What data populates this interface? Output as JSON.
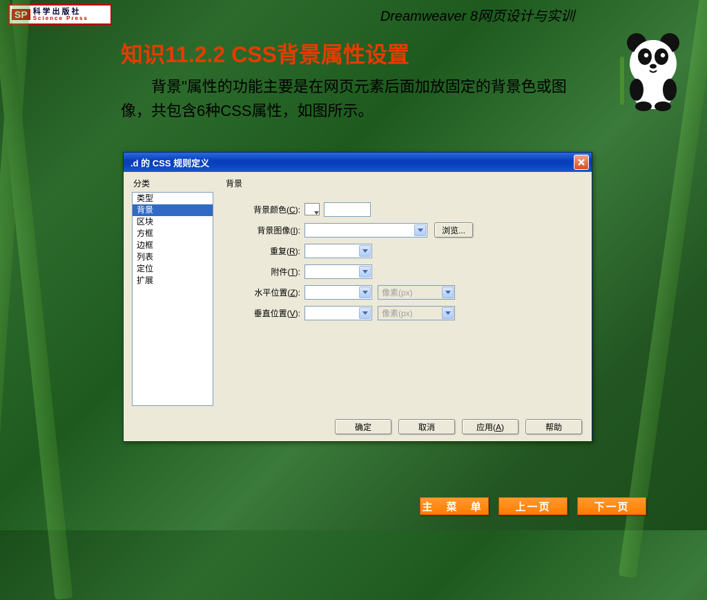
{
  "header": {
    "logo_cn": "科学出版社",
    "logo_en": "Science Press",
    "logo_badge": "SP",
    "title": "Dreamweaver 8网页设计与实训"
  },
  "page": {
    "title": "知识11.2.2  CSS背景属性设置",
    "desc": "背景\"属性的功能主要是在网页元素后面加放固定的背景色或图像，共包含6种CSS属性，如图所示。"
  },
  "dialog": {
    "title": ".d 的 CSS 规则定义",
    "category_label": "分类",
    "section_label": "背景",
    "categories": [
      "类型",
      "背景",
      "区块",
      "方框",
      "边框",
      "列表",
      "定位",
      "扩展"
    ],
    "selected_category_index": 1,
    "fields": {
      "bg_color": {
        "label_pre": "背景颜色(",
        "hotkey": "C",
        "label_post": "):"
      },
      "bg_image": {
        "label_pre": "背景图像(",
        "hotkey": "I",
        "label_post": "):",
        "browse": "浏览..."
      },
      "repeat": {
        "label_pre": "重复(",
        "hotkey": "R",
        "label_post": "):"
      },
      "attach": {
        "label_pre": "附件(",
        "hotkey": "T",
        "label_post": "):"
      },
      "hpos": {
        "label_pre": "水平位置(",
        "hotkey": "Z",
        "label_post": "):",
        "unit_ph": "像素(px)"
      },
      "vpos": {
        "label_pre": "垂直位置(",
        "hotkey": "V",
        "label_post": "):",
        "unit_ph": "像素(px)"
      }
    },
    "buttons": {
      "ok": "确定",
      "cancel": "取消",
      "apply_pre": "应用(",
      "apply_hot": "A",
      "apply_post": ")",
      "help": "帮助"
    }
  },
  "nav": {
    "main": "主 菜 单",
    "prev": "上一页",
    "next": "下一页"
  }
}
